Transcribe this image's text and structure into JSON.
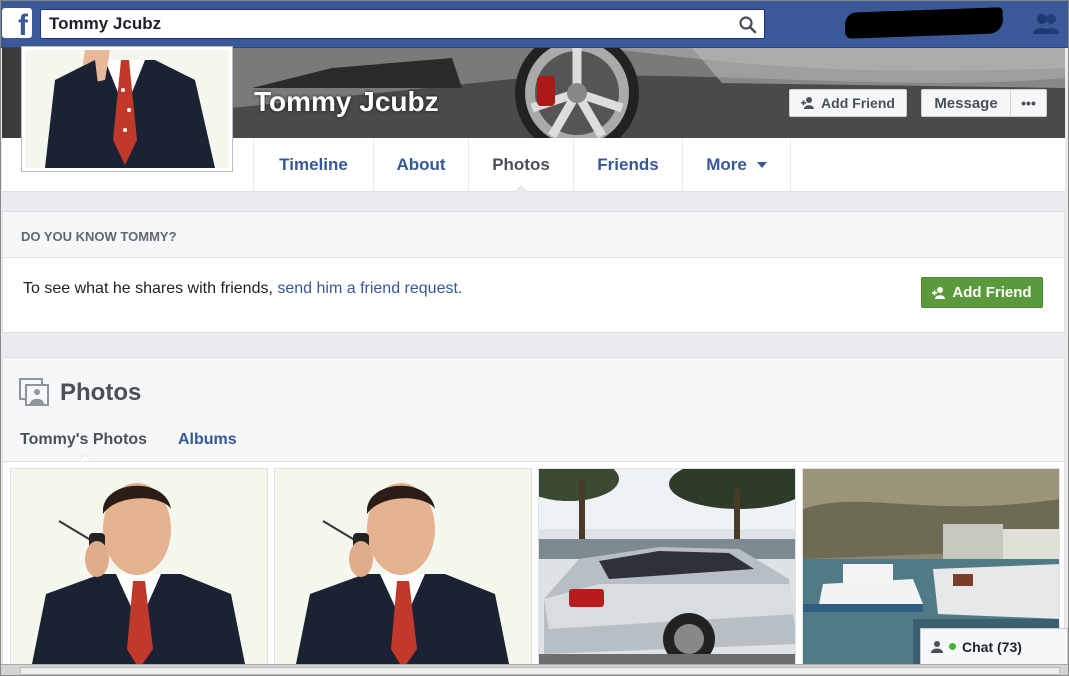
{
  "topbar": {
    "logo": "f",
    "search_value": "Tommy Jcubz",
    "search_icon": "search-icon",
    "friend_requests_icon": "friends-icon"
  },
  "cover": {
    "name": "Tommy Jcubz",
    "add_friend_label": "Add Friend",
    "message_label": "Message",
    "more_label": "•••"
  },
  "nav": {
    "tabs": [
      {
        "label": "Timeline"
      },
      {
        "label": "About"
      },
      {
        "label": "Photos"
      },
      {
        "label": "Friends"
      },
      {
        "label": "More"
      }
    ],
    "active": "Photos"
  },
  "know": {
    "header": "DO YOU KNOW TOMMY?",
    "text": "To see what he shares with friends, ",
    "link": "send him a friend request.",
    "button": "Add Friend"
  },
  "photos": {
    "title": "Photos",
    "subtabs": [
      {
        "label": "Tommy's Photos"
      },
      {
        "label": "Albums"
      }
    ]
  },
  "chat": {
    "label": "Chat (73)"
  },
  "colors": {
    "topbar": "#3b5998",
    "link": "#365899",
    "green_button": "#5b9a3c"
  }
}
